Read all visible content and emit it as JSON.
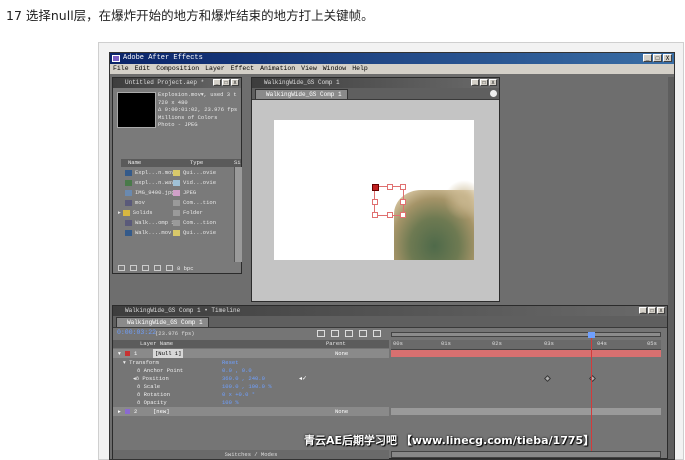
{
  "caption": "17 选择null层，在爆炸开始的地方和爆炸结束的地方打上关键帧。",
  "app": {
    "title": "Adobe After Effects",
    "menu": [
      "File",
      "Edit",
      "Composition",
      "Layer",
      "Effect",
      "Animation",
      "View",
      "Window",
      "Help"
    ],
    "window_buttons": [
      "_",
      "□",
      "X"
    ]
  },
  "project": {
    "panel_title": "Untitled Project.aep *",
    "preview_info": [
      "Explosion.mov▾, used 3 t",
      "720 x 480",
      "Δ 0:00:01:02, 23.976 fps",
      "Millions of Colors",
      "Photo - JPEG"
    ],
    "columns": {
      "name": "Name",
      "type": "Type",
      "size": "Si"
    },
    "items": [
      {
        "name": "Expl...n.mov",
        "type": "Qui...ovie",
        "color": "#d8c86a",
        "icon": "footage-icon"
      },
      {
        "name": "expl...n.wav",
        "type": "Vid...ovie",
        "color": "#9fc1d6",
        "icon": "audio-icon"
      },
      {
        "name": "IMG_9400.jpg",
        "type": "JPEG",
        "color": "#d0a0c8",
        "icon": "image-icon"
      },
      {
        "name": "mov",
        "type": "Com...tion",
        "color": "#9a9a9a",
        "icon": "composition-icon"
      },
      {
        "name": "Solids",
        "type": "Folder",
        "color": "#9a9a9a",
        "icon": "folder-icon"
      },
      {
        "name": "Walk...omp 1",
        "type": "Com...tion",
        "color": "#9a9a9a",
        "icon": "composition-icon"
      },
      {
        "name": "Walk....mov",
        "type": "Qui...ovie",
        "color": "#d8c86a",
        "icon": "footage-icon"
      }
    ],
    "bpc": "8 bpc"
  },
  "comp": {
    "panel_title": "WalkingWide_GS Comp 1",
    "tab": "WalkingWide_GS Comp 1"
  },
  "timeline": {
    "panel_title": "WalkingWide_GS Comp 1 • Timeline",
    "tab": "WalkingWide_GS Comp 1",
    "timecode": "0:00:03:22",
    "fps": "(23.976 fps)",
    "header": {
      "layer_name": "Layer Name",
      "parent": "Parent"
    },
    "ruler": [
      "00s",
      "01s",
      "02s",
      "03s",
      "04s",
      "05s"
    ],
    "layers": [
      {
        "num": "1",
        "name": "[Null 1]",
        "parent": "None"
      },
      {
        "num": "2",
        "name": "[new]",
        "parent": "None"
      }
    ],
    "transform": {
      "label": "Transform",
      "reset": "Reset",
      "properties": [
        {
          "name": "Anchor Point",
          "value": "0.0 , 0.0"
        },
        {
          "name": "Position",
          "value": "360.0 , 240.0"
        },
        {
          "name": "Scale",
          "value": "100.0 , 100.0 %"
        },
        {
          "name": "Rotation",
          "value": "0 x +0.0 °"
        },
        {
          "name": "Opacity",
          "value": "100 %"
        }
      ]
    },
    "switches_label": "Switches / Modes"
  },
  "watermark": "青云AE后期学习吧  【www.linecg.com/tieba/1775】"
}
